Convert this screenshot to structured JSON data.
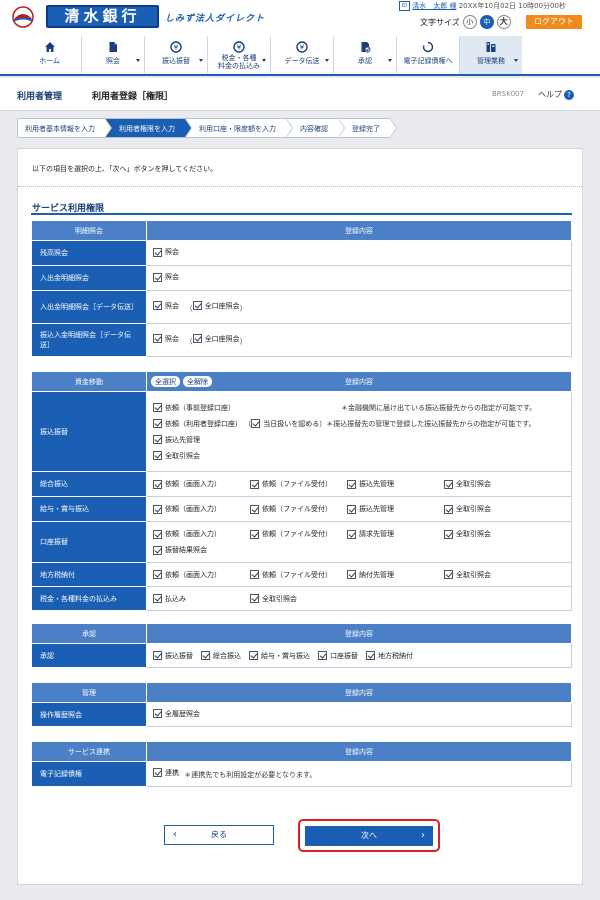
{
  "header": {
    "bank_name": "清水銀行",
    "service_name": "しみず法人ダイレクト",
    "user_icon": "user-id-icon",
    "user_name": "清水　太郎 様",
    "login_time": "20XX年10月02日 10時00分00秒",
    "fontsize_label": "文字サイズ",
    "fontsize_small": "小",
    "fontsize_medium": "中",
    "fontsize_large": "大",
    "logout_label": "ログアウト"
  },
  "nav": {
    "items": [
      {
        "label": "ホーム",
        "icon": "home-icon"
      },
      {
        "label": "照会",
        "icon": "document-icon"
      },
      {
        "label": "振込振替",
        "icon": "yen-transfer-icon"
      },
      {
        "label": "税金・各種料金の払込み",
        "label1": "税金・各種",
        "label2": "料金の払込み",
        "icon": "yen-pay-icon"
      },
      {
        "label": "データ伝送",
        "icon": "data-transfer-icon"
      },
      {
        "label": "承認",
        "icon": "approve-icon"
      },
      {
        "label": "電子記録債権へ",
        "icon": "e-bond-icon"
      },
      {
        "label": "管理業務",
        "icon": "management-icon"
      }
    ]
  },
  "titlebar": {
    "area": "利用者管理",
    "title": "利用者登録［権限］",
    "screen_id": "BRSK007",
    "help": "ヘルプ"
  },
  "steps": [
    "利用者基本情報を入力",
    "利用者権限を入力",
    "利用口座・限度額を入力",
    "内容確認",
    "登録完了"
  ],
  "instruction": "以下の項目を選択の上、「次へ」ボタンを押してください。",
  "section_title": "サービス利用権限",
  "inquiry": {
    "header_left": "明細照会",
    "header_right": "登録内容",
    "rows": [
      {
        "label": "残高照会",
        "items": [
          "照会"
        ]
      },
      {
        "label": "入出金明細照会",
        "items": [
          "照会"
        ]
      },
      {
        "label": "入出金明細照会［データ伝送］",
        "items": [
          "照会",
          "全口座照会"
        ]
      },
      {
        "label": "振込入金明細照会［データ伝送］",
        "items": [
          "照会",
          "全口座照会"
        ]
      }
    ]
  },
  "funds": {
    "header_left": "資金移動",
    "select_all": "全選択",
    "deselect_all": "全解除",
    "header_right": "登録内容",
    "transfer": {
      "label": "振込振替",
      "req_reg": "依頼（事前登録口座）",
      "req_reg_note": "＊金融機関に届け出ている振込振替先からの指定が可能です。",
      "req_user": "依頼（利用者登録口座）",
      "same_day": "当日扱いを認める",
      "req_user_note": "＊振込振替先の管理で登録した振込振替先からの指定が可能です。",
      "dest_mgmt": "振込先管理",
      "all_inquiry": "全取引照会"
    },
    "general": {
      "label": "総合振込",
      "items": [
        "依頼（画面入力）",
        "依頼（ファイル受付）",
        "振込先管理",
        "全取引照会"
      ]
    },
    "salary": {
      "label": "給与・賞与振込",
      "items": [
        "依頼（画面入力）",
        "依頼（ファイル受付）",
        "振込先管理",
        "全取引照会"
      ]
    },
    "debit": {
      "label": "口座振替",
      "items": [
        "依頼（画面入力）",
        "依頼（ファイル受付）",
        "請求先管理",
        "全取引照会"
      ],
      "extra": "振替結果照会"
    },
    "local_tax": {
      "label": "地方税納付",
      "items": [
        "依頼（画面入力）",
        "依頼（ファイル受付）",
        "納付先管理",
        "全取引照会"
      ]
    },
    "tax_pay": {
      "label": "税金・各種料金の払込み",
      "items": [
        "払込み",
        "全取引照会"
      ]
    }
  },
  "approval": {
    "header_left": "承認",
    "header_right": "登録内容",
    "label": "承認",
    "items": [
      "振込振替",
      "総合振込",
      "給与・賞与振込",
      "口座振替",
      "地方税納付"
    ]
  },
  "management": {
    "header_left": "管理",
    "header_right": "登録内容",
    "label": "操作履歴照会",
    "item": "全履歴照会"
  },
  "service": {
    "header_left": "サービス連携",
    "header_right": "登録内容",
    "label": "電子記録債権",
    "item": "連携",
    "note": "＊連携先でも利用設定が必要となります。"
  },
  "buttons": {
    "back": "戻る",
    "next": "次へ"
  },
  "colors": {
    "primary": "#1a5fb4",
    "header_cell": "#4b7fc6",
    "logout": "#f08a1c",
    "highlight": "#e02020"
  }
}
